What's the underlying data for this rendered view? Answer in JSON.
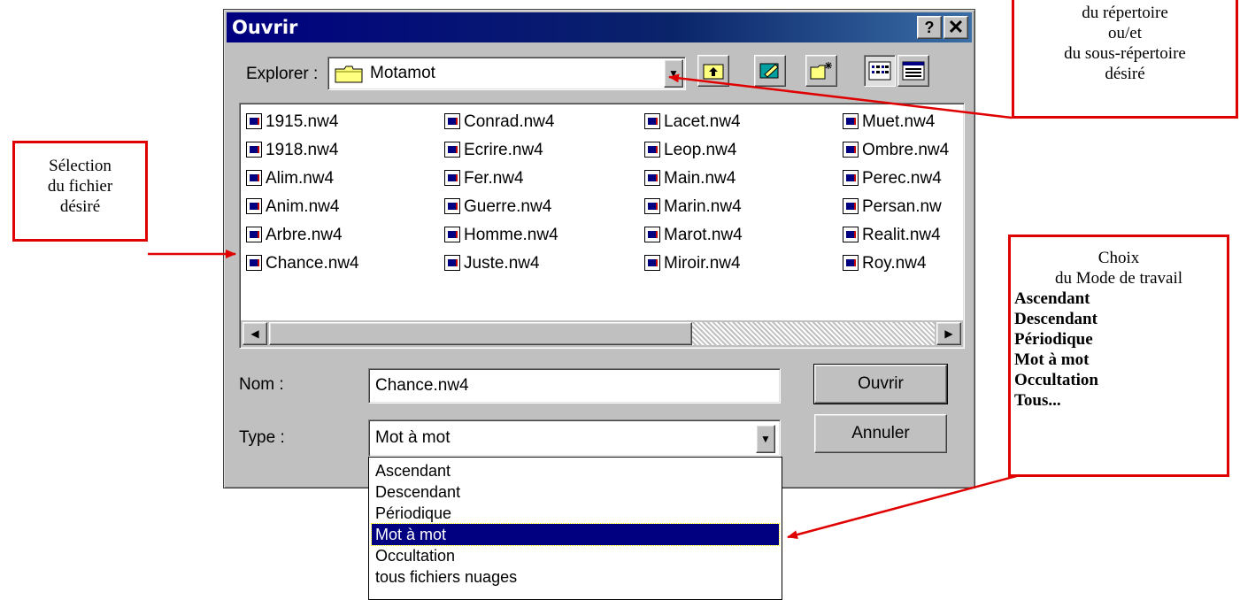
{
  "dialog": {
    "title": "Ouvrir",
    "help_button": "?",
    "close_button": "✕",
    "explorer_label": "Explorer :",
    "explorer_value": "Motamot",
    "files": [
      [
        "1915.nw4",
        "1918.nw4",
        "Alim.nw4",
        "Anim.nw4",
        "Arbre.nw4",
        "Chance.nw4"
      ],
      [
        "Conrad.nw4",
        "Ecrire.nw4",
        "Fer.nw4",
        "Guerre.nw4",
        "Homme.nw4",
        "Juste.nw4"
      ],
      [
        "Lacet.nw4",
        "Leop.nw4",
        "Main.nw4",
        "Marin.nw4",
        "Marot.nw4",
        "Miroir.nw4"
      ],
      [
        "Muet.nw4",
        "Ombre.nw4",
        "Perec.nw4",
        "Persan.nw",
        "Realit.nw4",
        "Roy.nw4"
      ]
    ],
    "name_label": "Nom :",
    "name_value": "Chance.nw4",
    "type_label": "Type :",
    "type_value": "Mot à mot",
    "open_button": "Ouvrir",
    "cancel_button": "Annuler",
    "type_options": [
      "Ascendant",
      "Descendant",
      "Périodique",
      "Mot à mot",
      "Occultation",
      "tous fichiers nuages"
    ],
    "selected_type_index": 3
  },
  "callouts": {
    "file": [
      "Sélection",
      "du fichier",
      "désiré"
    ],
    "directory": [
      "du répertoire",
      "ou/et",
      "du sous-répertoire",
      "désiré"
    ],
    "mode_title": [
      "Choix",
      "du Mode de travail"
    ],
    "mode_items": [
      "Ascendant",
      "Descendant",
      "Périodique",
      "Mot à mot",
      "Occultation",
      "Tous..."
    ]
  },
  "colors": {
    "titlebar": "#000080",
    "selection": "#000080",
    "callout_border": "#e00000",
    "arrow": "#e00000"
  }
}
